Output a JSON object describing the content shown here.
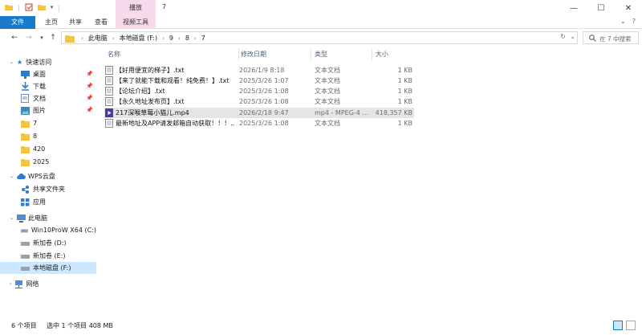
{
  "window": {
    "title": "7",
    "contextual_tab": "播放"
  },
  "ribbon": {
    "tabs": [
      "文件",
      "主页",
      "共享",
      "查看",
      "视频工具"
    ]
  },
  "address": {
    "crumbs": [
      "此电脑",
      "本地磁盘 (F:)",
      "9",
      "8",
      "7"
    ],
    "search_placeholder": "在 7 中搜索"
  },
  "nav": {
    "quick_access": "快速访问",
    "items_quick": [
      {
        "label": "桌面",
        "icon": "desktop-icon",
        "pinned": true
      },
      {
        "label": "下载",
        "icon": "download-icon",
        "pinned": true
      },
      {
        "label": "文档",
        "icon": "document-icon",
        "pinned": true
      },
      {
        "label": "图片",
        "icon": "picture-icon",
        "pinned": true
      },
      {
        "label": "7",
        "icon": "folder-icon",
        "pinned": false
      },
      {
        "label": "8",
        "icon": "folder-icon",
        "pinned": false
      },
      {
        "label": "420",
        "icon": "folder-icon",
        "pinned": false
      },
      {
        "label": "2025",
        "icon": "folder-icon",
        "pinned": false
      }
    ],
    "wps": "WPS云盘",
    "items_wps": [
      {
        "label": "共享文件夹",
        "icon": "shared-folder-icon"
      },
      {
        "label": "应用",
        "icon": "apps-icon"
      }
    ],
    "this_pc": "此电脑",
    "drives": [
      {
        "label": "Win10ProW X64 (C:)",
        "icon": "drive-icon"
      },
      {
        "label": "新加卷 (D:)",
        "icon": "drive-icon"
      },
      {
        "label": "新加卷 (E:)",
        "icon": "drive-icon"
      },
      {
        "label": "本地磁盘 (F:)",
        "icon": "drive-icon",
        "selected": true
      }
    ],
    "network": "网络"
  },
  "columns": {
    "name": "名称",
    "date": "修改日期",
    "type": "类型",
    "size": "大小"
  },
  "files": [
    {
      "name": "【好用便宜的梯子】.txt",
      "date": "2026/1/9 8:18",
      "type": "文本文档",
      "size": "1 KB",
      "icon": "txt-icon"
    },
    {
      "name": "【来了就能下载和观看！纯免费！】.txt",
      "date": "2025/3/26 1:07",
      "type": "文本文档",
      "size": "1 KB",
      "icon": "txt-icon"
    },
    {
      "name": "【论坛介绍】.txt",
      "date": "2025/3/26 1:08",
      "type": "文本文档",
      "size": "1 KB",
      "icon": "txt-icon"
    },
    {
      "name": "【永久地址发布页】.txt",
      "date": "2025/3/26 1:08",
      "type": "文本文档",
      "size": "1 KB",
      "icon": "txt-icon"
    },
    {
      "name": "217深喉草莓小猫儿.mp4",
      "date": "2026/2/18 9:47",
      "type": "mp4 - MPEG-4 ...",
      "size": "418,357 KB",
      "icon": "video-icon",
      "selected": true
    },
    {
      "name": "最新地址及APP请发邮箱自动获取！！！....",
      "date": "2025/3/26 1:08",
      "type": "文本文档",
      "size": "1 KB",
      "icon": "txt-icon"
    }
  ],
  "status": {
    "count": "6 个项目",
    "selection": "选中 1 个项目  408 MB"
  },
  "colors": {
    "accent": "#1979ca",
    "context_tab": "#f6d9ea",
    "selection": "#cce8ff"
  }
}
